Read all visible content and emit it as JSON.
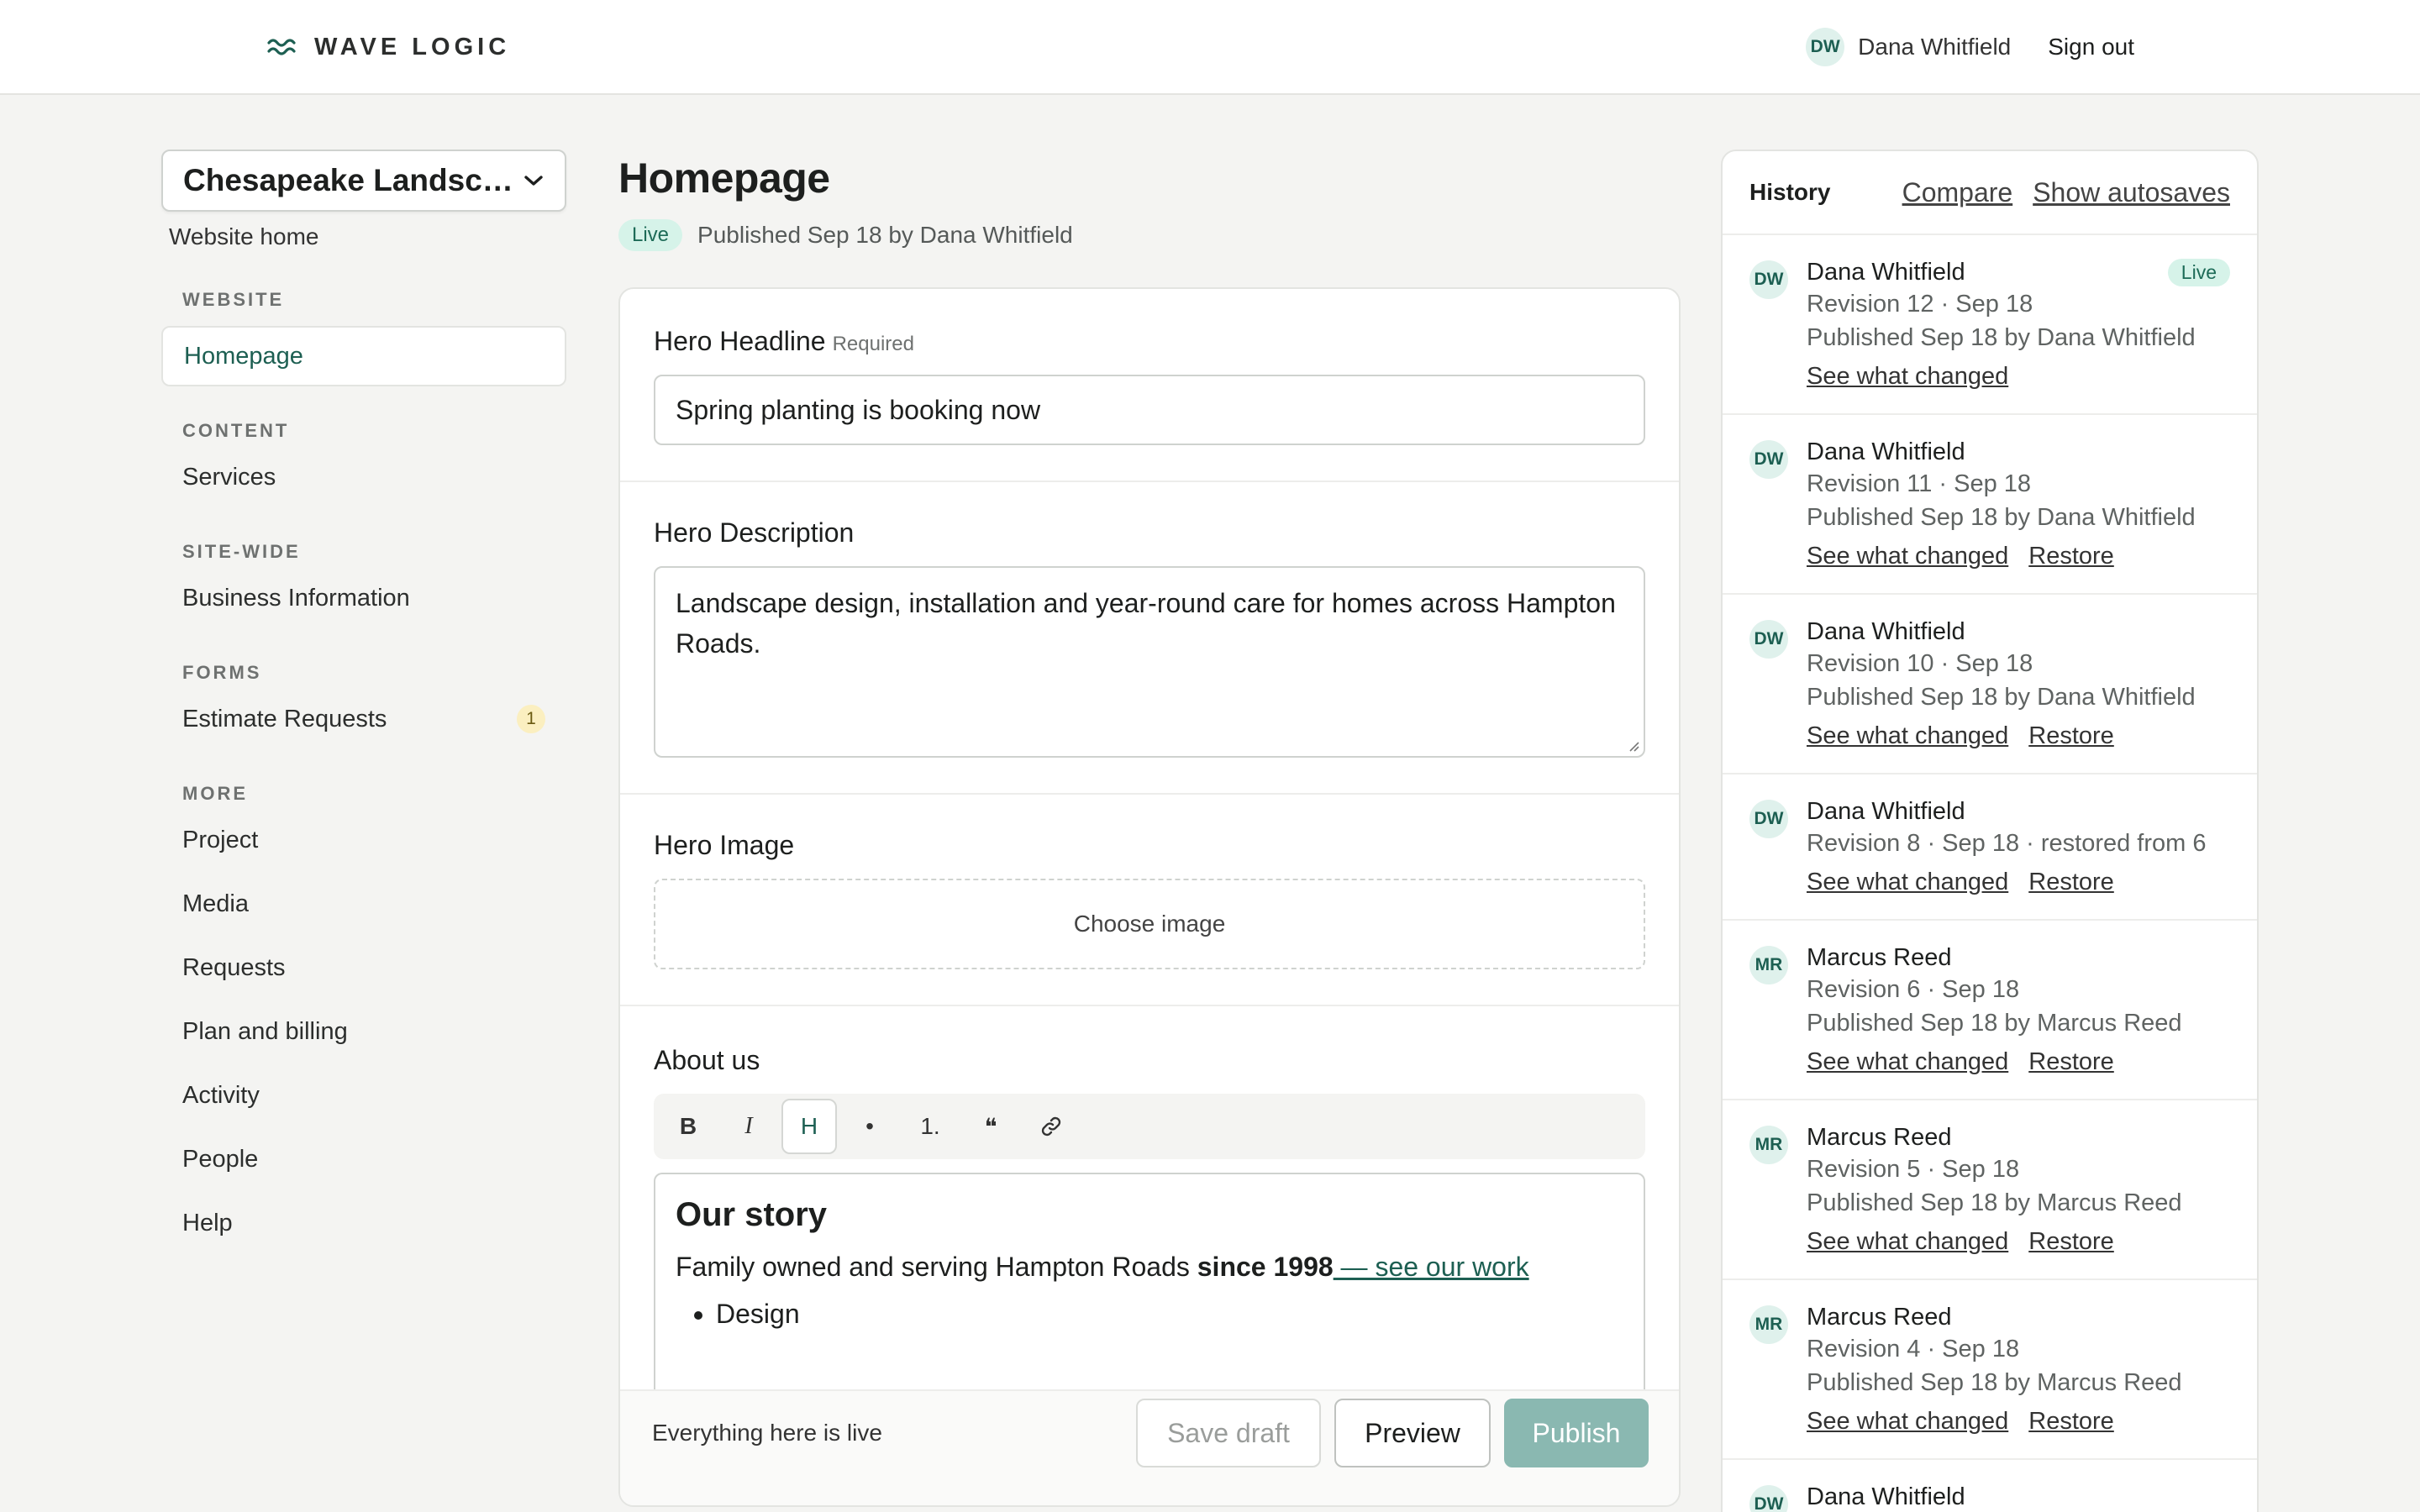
{
  "brand": {
    "name": "WAVE LOGIC",
    "logo_icon": "wave-logo-icon",
    "accent": "#1d5f52"
  },
  "user": {
    "initials": "DW",
    "name": "Dana Whitfield",
    "signout_label": "Sign out"
  },
  "sidebar": {
    "site_select": "Chesapeake Landscapi...",
    "website_home": "Website home",
    "sections": [
      {
        "heading": "WEBSITE",
        "items": [
          {
            "label": "Homepage",
            "active": true
          }
        ]
      },
      {
        "heading": "CONTENT",
        "items": [
          {
            "label": "Services"
          }
        ]
      },
      {
        "heading": "SITE-WIDE",
        "items": [
          {
            "label": "Business Information"
          }
        ]
      },
      {
        "heading": "FORMS",
        "items": [
          {
            "label": "Estimate Requests",
            "badge": "1"
          }
        ]
      },
      {
        "heading": "MORE",
        "items": [
          {
            "label": "Project"
          },
          {
            "label": "Media"
          },
          {
            "label": "Requests"
          },
          {
            "label": "Plan and billing"
          },
          {
            "label": "Activity"
          },
          {
            "label": "People"
          },
          {
            "label": "Help"
          }
        ]
      }
    ]
  },
  "main": {
    "title": "Homepage",
    "status_pill": "Live",
    "published_text": "Published Sep 18 by Dana Whitfield",
    "fields": {
      "hero_headline": {
        "label": "Hero Headline",
        "required": "Required",
        "value": "Spring planting is booking now"
      },
      "hero_description": {
        "label": "Hero Description",
        "value": "Landscape design, installation and year-round care for homes across Hampton Roads."
      },
      "hero_image": {
        "label": "Hero Image",
        "button": "Choose image"
      },
      "about": {
        "label": "About us",
        "toolbar": [
          "B",
          "I",
          "H",
          "•",
          "1.",
          "❝",
          "link-icon"
        ],
        "heading": "Our story",
        "para_start": "Family owned and serving Hampton Roads ",
        "para_bold": "since 1998",
        "para_link": " — see our work",
        "list": [
          "Design"
        ]
      }
    },
    "actionbar": {
      "status": "Everything here is live",
      "save_draft": "Save draft",
      "preview": "Preview",
      "publish": "Publish"
    }
  },
  "history": {
    "title": "History",
    "compare": "Compare",
    "show_autosaves": "Show autosaves",
    "revisions": [
      {
        "initials": "DW",
        "name": "Dana Whitfield",
        "live": "Live",
        "meta": "Revision 12 · Sep 18",
        "published": "Published Sep 18 by Dana Whitfield",
        "actions": [
          "See what changed"
        ]
      },
      {
        "initials": "DW",
        "name": "Dana Whitfield",
        "meta": "Revision 11 · Sep 18",
        "published": "Published Sep 18 by Dana Whitfield",
        "actions": [
          "See what changed",
          "Restore"
        ]
      },
      {
        "initials": "DW",
        "name": "Dana Whitfield",
        "meta": "Revision 10 · Sep 18",
        "published": "Published Sep 18 by Dana Whitfield",
        "actions": [
          "See what changed",
          "Restore"
        ]
      },
      {
        "initials": "DW",
        "name": "Dana Whitfield",
        "meta": "Revision 8 · Sep 18 · restored from 6",
        "actions": [
          "See what changed",
          "Restore"
        ]
      },
      {
        "initials": "MR",
        "name": "Marcus Reed",
        "meta": "Revision 6 · Sep 18",
        "published": "Published Sep 18 by Marcus Reed",
        "actions": [
          "See what changed",
          "Restore"
        ]
      },
      {
        "initials": "MR",
        "name": "Marcus Reed",
        "meta": "Revision 5 · Sep 18",
        "published": "Published Sep 18 by Marcus Reed",
        "actions": [
          "See what changed",
          "Restore"
        ]
      },
      {
        "initials": "MR",
        "name": "Marcus Reed",
        "meta": "Revision 4 · Sep 18",
        "published": "Published Sep 18 by Marcus Reed",
        "actions": [
          "See what changed",
          "Restore"
        ]
      },
      {
        "initials": "DW",
        "name": "Dana Whitfield",
        "meta": "",
        "actions": []
      }
    ]
  }
}
